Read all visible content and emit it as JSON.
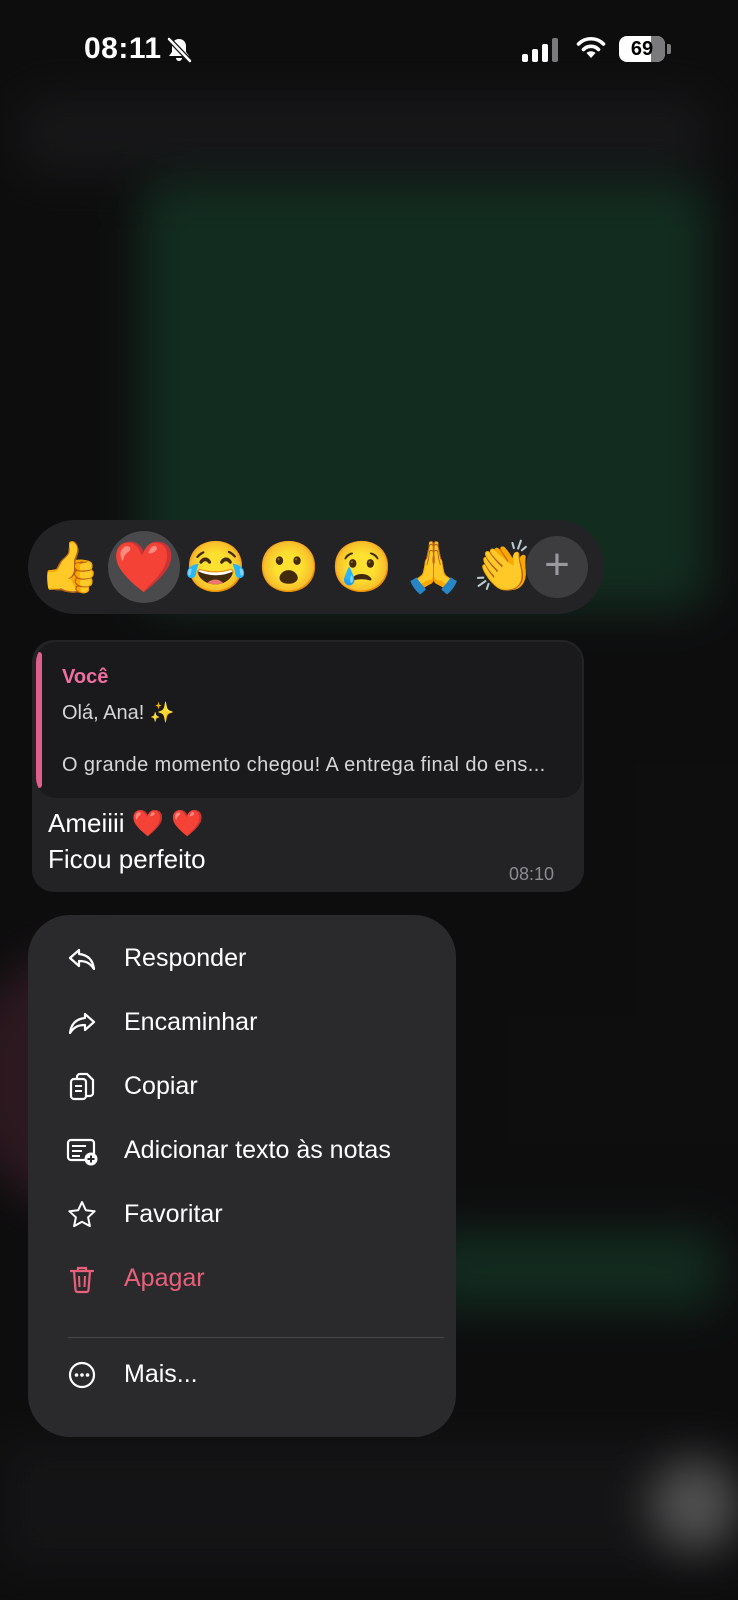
{
  "status_bar": {
    "time": "08:11",
    "battery": "69"
  },
  "reactions": {
    "items": [
      {
        "emoji": "👍",
        "name": "thumbs-up"
      },
      {
        "emoji": "❤️",
        "name": "red-heart",
        "selected": true
      },
      {
        "emoji": "😂",
        "name": "tears-of-joy"
      },
      {
        "emoji": "😮",
        "name": "open-mouth"
      },
      {
        "emoji": "😢",
        "name": "crying-face"
      },
      {
        "emoji": "🙏",
        "name": "folded-hands"
      },
      {
        "emoji": "👏",
        "name": "clapping-hands"
      }
    ],
    "more": "+"
  },
  "message": {
    "quote_author": "Você",
    "quote_line1": "Olá, Ana! ✨",
    "quote_line2": "O grande momento chegou! A entrega final do ens...",
    "line1": "Ameiiii ❤️ ❤️",
    "line2": "Ficou perfeito",
    "time": "08:10"
  },
  "menu": {
    "reply": "Responder",
    "forward": "Encaminhar",
    "copy": "Copiar",
    "add_note": "Adicionar texto às notas",
    "favorite": "Favoritar",
    "delete": "Apagar",
    "more": "Mais..."
  },
  "colors": {
    "accent_pink": "#ef6fa0",
    "danger": "#e8607a"
  }
}
